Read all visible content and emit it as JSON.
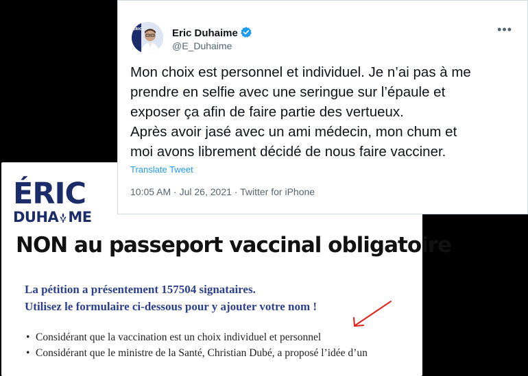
{
  "tweet": {
    "author_name": "Eric Duhaime",
    "handle": "@E_Duhaime",
    "text_lines": [
      "Mon choix est personnel et individuel. Je n’ai pas à me",
      "prendre en selfie avec une seringue sur l’épaule et",
      "exposer ça afin de faire partie des vertueux.",
      "Après avoir jasé avec un ami médecin, mon chum et",
      "moi avons librement décidé de nous faire vacciner."
    ],
    "translate_label": "Translate Tweet",
    "time": "10:05 AM",
    "date": "Jul 26, 2021",
    "source": "Twitter for iPhone",
    "more_icon": "more-dots-icon",
    "colors": {
      "link": "#1d9bf0",
      "verified": "#1d9bf0",
      "secondary": "#536471"
    }
  },
  "petition": {
    "logo_line1": "ÉRIC",
    "logo_line2_prefix": "DUHA",
    "logo_line2_suffix": "ME",
    "title": "NON au passeport vaccinal obligatoire",
    "count_text": "La pétition a présentement 157504 signataires.",
    "cta_text": "Utilisez le formulaire ci-dessous pour y ajouter votre nom !",
    "bullets": [
      "Considérant que la vaccination est un choix individuel et personnel",
      "Considérant que le ministre de la Santé, Christian Dubé, a proposé l’idée d’un"
    ],
    "colors": {
      "brand": "#1b2c6b",
      "link_text": "#2b3f8f",
      "arrow": "#e0201b"
    }
  }
}
